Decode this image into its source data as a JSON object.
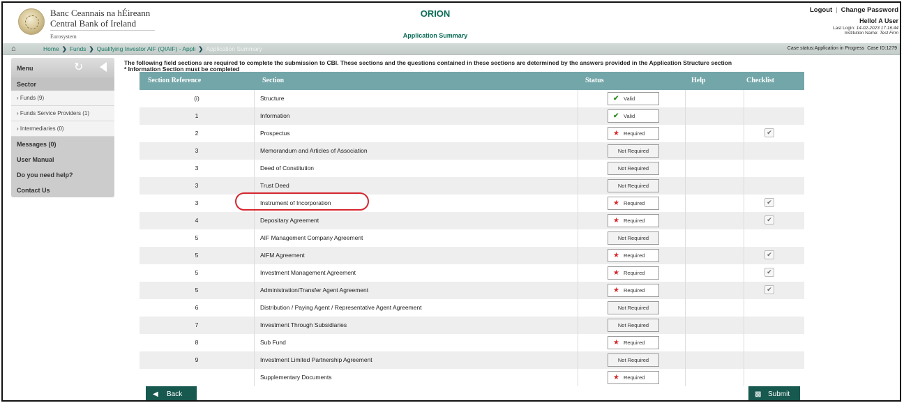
{
  "header": {
    "bank_name_irish": "Banc Ceannais na hÉireann",
    "bank_name_english": "Central Bank of Ireland",
    "eurosystem": "Eurosystem",
    "app_title": "ORION",
    "page_subtitle": "Application Summary",
    "logout": "Logout",
    "change_password": "Change Password",
    "hello": "Hello! A User",
    "last_login_label": "Last Login:",
    "last_login_value": "14-02-2023 17:16:44",
    "institution_label": "Institution Name:",
    "institution_value": "Test Firm"
  },
  "breadcrumb": {
    "items": [
      "Home",
      "Funds",
      "Qualifying Investor AIF (QIAIF) - Appli",
      "Application Summary"
    ],
    "case_status": "Case status:Application in Progress",
    "case_id": "Case ID:1279"
  },
  "sidebar": {
    "menu_label": "Menu",
    "sector_label": "Sector",
    "sub_items": [
      {
        "label": "Funds (9)"
      },
      {
        "label": "Funds Service Providers (1)"
      },
      {
        "label": "Intermediaries (0)"
      }
    ],
    "main_items": [
      {
        "label": "Messages (0)"
      },
      {
        "label": "User Manual"
      },
      {
        "label": "Do you need help?"
      },
      {
        "label": "Contact Us"
      }
    ]
  },
  "intro": {
    "line1": "The following field sections are required to complete the submission to CBI. These sections and the questions contained in these sections are determined by the answers provided in the Application Structure section",
    "line2": "* Information Section must be completed"
  },
  "table": {
    "headers": {
      "ref": "Section Reference",
      "section": "Section",
      "status": "Status",
      "help": "Help",
      "checklist": "Checklist"
    },
    "rows": [
      {
        "ref": "(i)",
        "section": "Structure",
        "status": "Valid",
        "checklist": false
      },
      {
        "ref": "1",
        "section": "Information",
        "status": "Valid",
        "checklist": false
      },
      {
        "ref": "2",
        "section": "Prospectus",
        "status": "Required",
        "checklist": true
      },
      {
        "ref": "3",
        "section": "Memorandum and Articles of Association",
        "status": "Not Required",
        "checklist": false
      },
      {
        "ref": "3",
        "section": "Deed of Constitution",
        "status": "Not Required",
        "checklist": false
      },
      {
        "ref": "3",
        "section": "Trust Deed",
        "status": "Not Required",
        "checklist": false
      },
      {
        "ref": "3",
        "section": "Instrument of Incorporation",
        "status": "Required",
        "checklist": true
      },
      {
        "ref": "4",
        "section": "Depositary Agreement",
        "status": "Required",
        "checklist": true
      },
      {
        "ref": "5",
        "section": "AIF Management Company Agreement",
        "status": "Not Required",
        "checklist": false
      },
      {
        "ref": "5",
        "section": "AIFM Agreement",
        "status": "Required",
        "checklist": true
      },
      {
        "ref": "5",
        "section": "Investment Management Agreement",
        "status": "Required",
        "checklist": true
      },
      {
        "ref": "5",
        "section": "Administration/Transfer Agent Agreement",
        "status": "Required",
        "checklist": true
      },
      {
        "ref": "6",
        "section": "Distribution / Paying Agent / Representative Agent Agreement",
        "status": "Not Required",
        "checklist": false
      },
      {
        "ref": "7",
        "section": "Investment Through Subsidiaries",
        "status": "Not Required",
        "checklist": false
      },
      {
        "ref": "8",
        "section": "Sub Fund",
        "status": "Required",
        "checklist": false
      },
      {
        "ref": "9",
        "section": "Investment Limited Partnership Agreement",
        "status": "Not Required",
        "checklist": false
      },
      {
        "ref": "",
        "section": "Supplementary Documents",
        "status": "Required",
        "checklist": false
      }
    ]
  },
  "buttons": {
    "back": "Back",
    "submit": "Submit"
  },
  "colors": {
    "accent": "#0b6b57",
    "table_header": "#73a6a9",
    "button": "#17584f",
    "required_star": "#d6262b",
    "valid_check": "#2f8b23",
    "highlight": "#d5262f"
  }
}
